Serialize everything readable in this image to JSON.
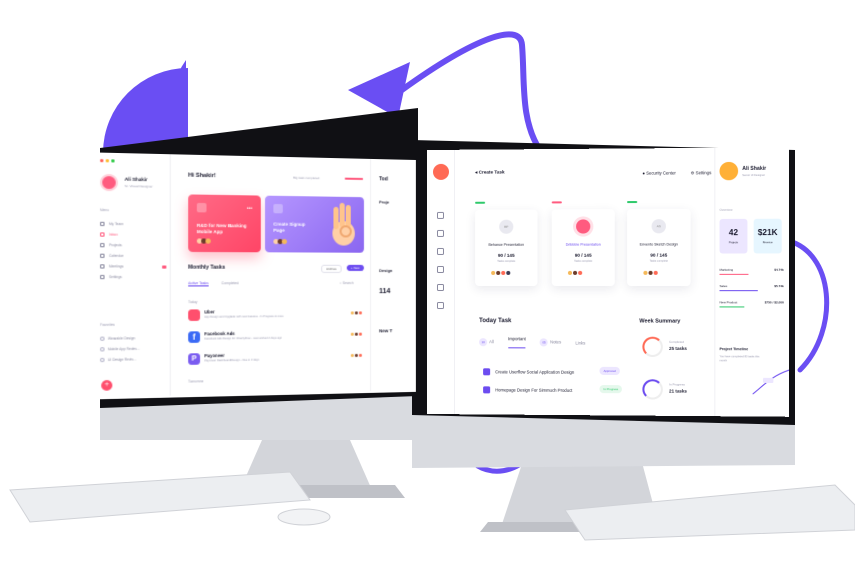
{
  "colors": {
    "accent_purple": "#6c4cf0",
    "accent_pink": "#ff5b7f",
    "accent_coral": "#ff6a55",
    "bezel": "#101014",
    "stand": "#d9dbe0"
  },
  "left_app": {
    "profile": {
      "name": "Ali Shakir",
      "role": "Sr. Visual Designer"
    },
    "menu_heading": "Menu",
    "menu": [
      {
        "label": "My Team",
        "active": false
      },
      {
        "label": "Inbox",
        "active": true,
        "badge": ""
      },
      {
        "label": "Projects",
        "active": false
      },
      {
        "label": "Calendar",
        "active": false
      },
      {
        "label": "Meetings",
        "active": false,
        "badge": ""
      },
      {
        "label": "Settings",
        "active": false
      }
    ],
    "favorites_heading": "Favorites",
    "favorites": [
      {
        "label": "Wearable Design"
      },
      {
        "label": "Mobile App Redes..."
      },
      {
        "label": "UI Design Revis..."
      }
    ],
    "greeting": "Hi Shakir!",
    "status_text": "Big task completed",
    "cards": [
      {
        "title_line1": "R&D for New Banking",
        "title_line2": "Mobile App",
        "color": "#ff5b7f"
      },
      {
        "title_line1": "Create Signup",
        "title_line2": "Page",
        "color": "#9a78f5"
      }
    ],
    "monthly_tasks": {
      "title": "Monthly Tasks",
      "archive_label": "Archive",
      "new_label": "+ New",
      "tabs": [
        "Active Tasks",
        "Completed"
      ],
      "search_label": "Search",
      "today_label": "Today",
      "tomorrow_label": "Tomorrow",
      "tasks": [
        {
          "name": "Uber",
          "desc": "App Design and Upgrade with new features - In Progress & more",
          "icon_color": "#ff4f6d"
        },
        {
          "name": "Facebook Ads",
          "desc": "Facebook Ads Design for CharityFlow - Last worked 2 days ago",
          "icon_color": "#3b6af5"
        },
        {
          "name": "Payoneer",
          "desc": "Payoneer Dashboard Design - Due in 3 days",
          "icon_color": "#7a5cf0"
        }
      ]
    },
    "right_panel": {
      "heading": "Tod",
      "projects": "Proje",
      "design": "Design",
      "number": "114",
      "new_label": "New T"
    }
  },
  "right_app": {
    "create_task": "Create Task",
    "security_center": "Security Center",
    "settings": "Settings",
    "project_cards": [
      {
        "title": "Behance Presentation",
        "progress": "90 / 145",
        "status": "Tasks complete",
        "accent": "#2fc96b",
        "circle": "#e9e9f0",
        "highlight": false,
        "initials": "BP"
      },
      {
        "title": "Dribbble Presentation",
        "progress": "90 / 145",
        "status": "Tasks complete",
        "accent": "#ff5b7f",
        "circle": "#ff5b7f",
        "highlight": true,
        "initials": ""
      },
      {
        "title": "Envento Sketch Design",
        "progress": "90 / 145",
        "status": "Tasks complete",
        "accent": "#2fc96b",
        "circle": "#e9e9f0",
        "highlight": false,
        "initials": "AS"
      }
    ],
    "today_task": {
      "title": "Today Task",
      "tabs": [
        {
          "label": "All",
          "count": "10"
        },
        {
          "label": "Important",
          "count": ""
        },
        {
          "label": "Notes",
          "count": "05"
        },
        {
          "label": "Links",
          "count": ""
        }
      ],
      "items": [
        {
          "label": "Create Userflow Social Application Design",
          "status": "Approved",
          "pill_bg": "#ece6ff",
          "pill_fg": "#6c4cf0"
        },
        {
          "label": "Homepage Design For Simmuch Product",
          "status": "In Progress",
          "pill_bg": "#e5f8ec",
          "pill_fg": "#2fc96b"
        }
      ]
    },
    "week_summary": {
      "title": "Week Summary",
      "rows": [
        {
          "label": "Completed",
          "value": "25 tasks",
          "ring_color": "#ff6a55"
        },
        {
          "label": "In Progress",
          "value": "21 tasks",
          "ring_color": "#6c4cf0"
        }
      ]
    },
    "profile": {
      "name": "Ali Shakir",
      "role": "Senior UI Designer",
      "overview_label": "Overview",
      "stats": [
        {
          "value": "42",
          "label": "Projects",
          "bg": "#ece6ff",
          "fg": "#1b1b2f"
        },
        {
          "value": "$21K",
          "label": "Revenue",
          "bg": "#e6f6ff",
          "fg": "#1b1b2f"
        }
      ],
      "lines": [
        {
          "label": "Marketing",
          "value": "$4.74k",
          "bar_color": "#ff5b7f",
          "fill": 0.45
        },
        {
          "label": "Sales",
          "value": "$5.74k",
          "bar_color": "#6c4cf0",
          "fill": 0.6
        },
        {
          "label": "New Product",
          "value": "$750 / $2,000",
          "bar_color": "#2fc96b",
          "fill": 0.38
        }
      ],
      "timeline_title": "Project Timeline",
      "timeline_desc": "You have completed 80 tasks this month"
    }
  }
}
